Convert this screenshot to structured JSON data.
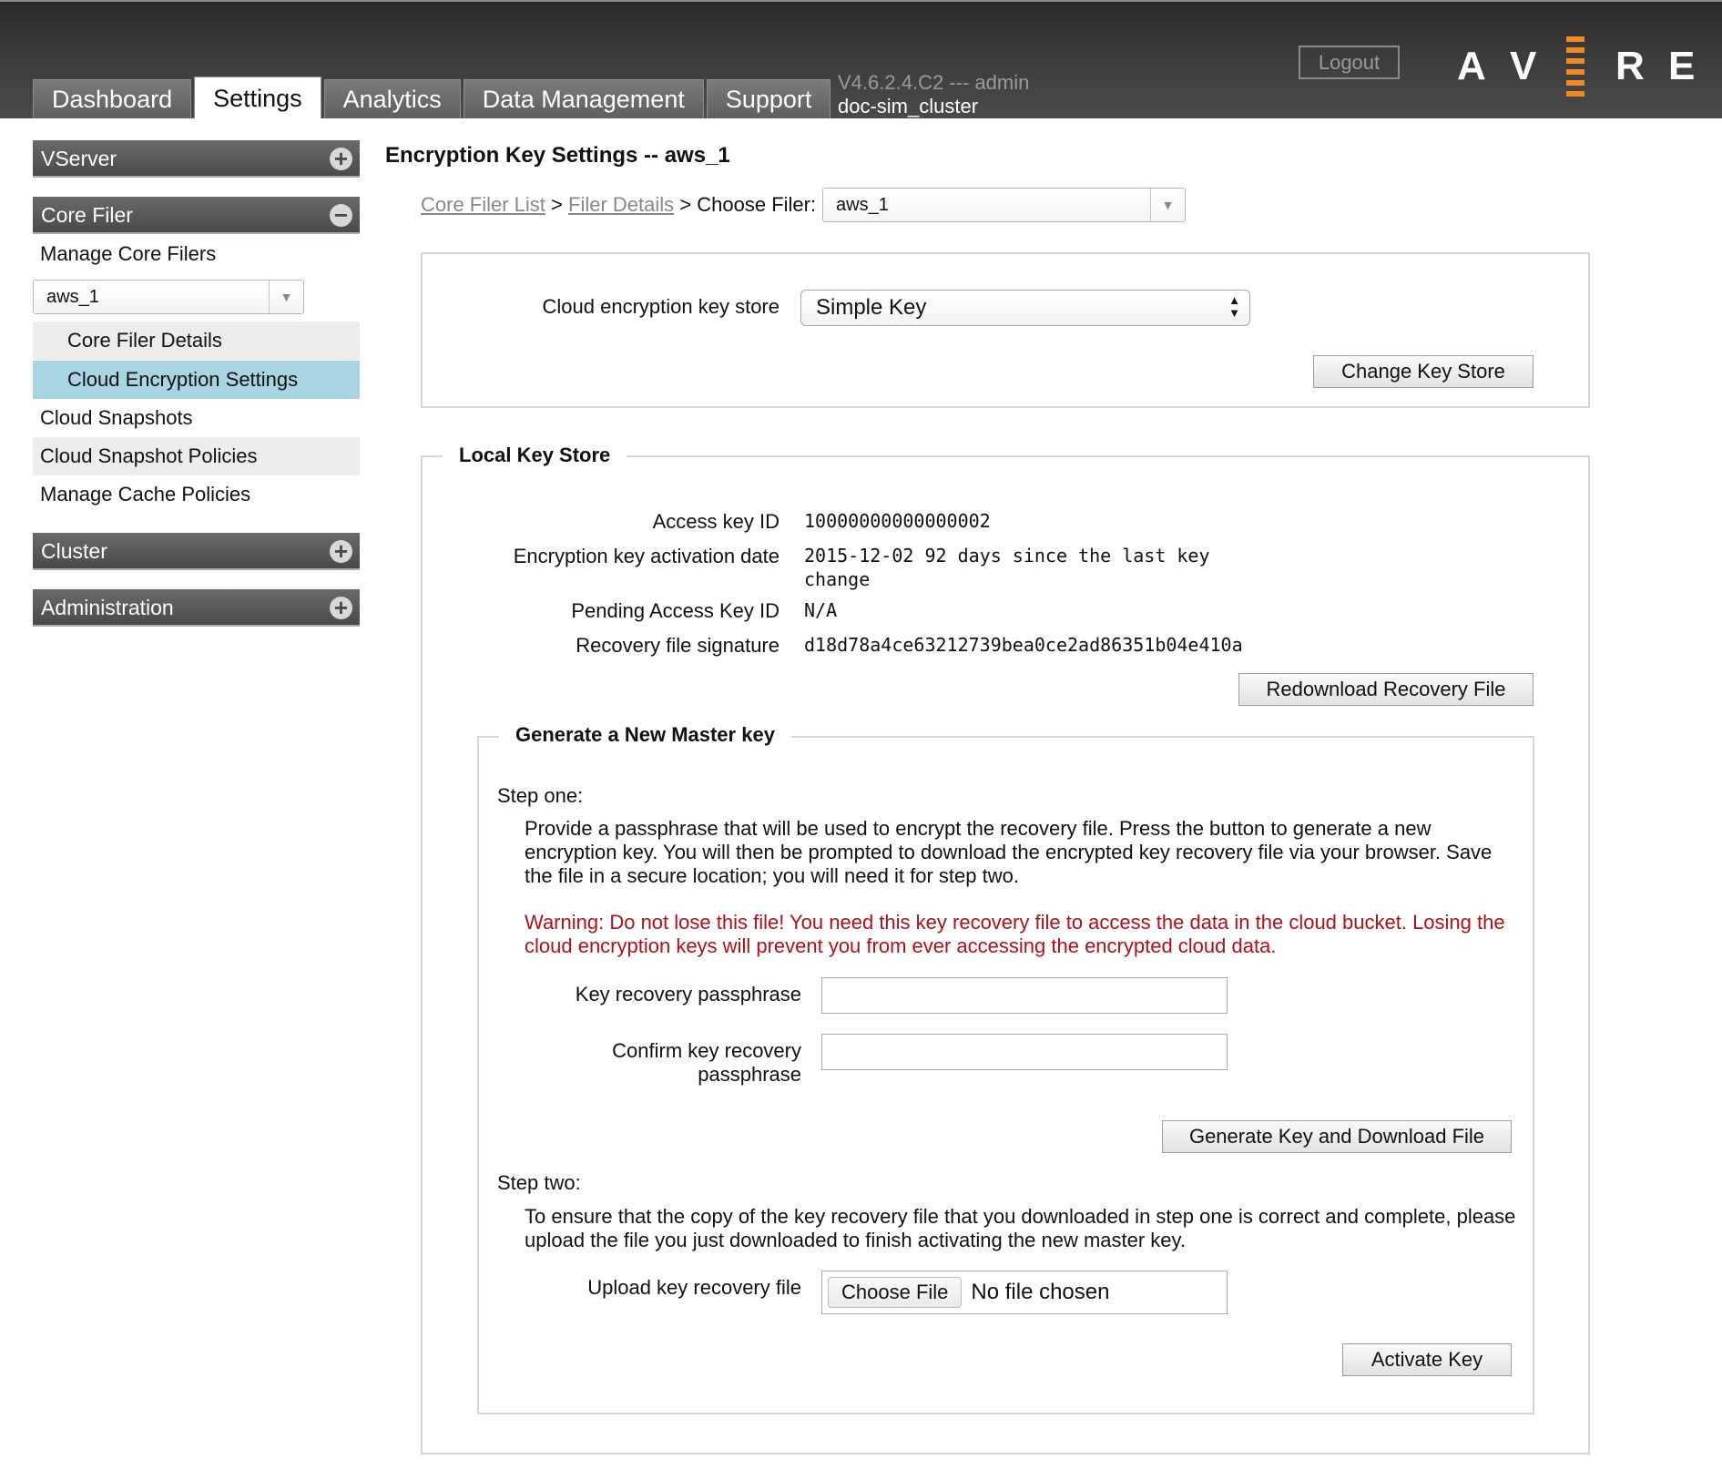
{
  "header": {
    "tabs": [
      "Dashboard",
      "Settings",
      "Analytics",
      "Data Management",
      "Support"
    ],
    "version": "V4.6.2.4.C2 --- admin",
    "cluster": "doc-sim_cluster",
    "logout": "Logout",
    "logo_letters": [
      "A",
      "V",
      "E",
      "R",
      "E"
    ]
  },
  "sidebar": {
    "vserver": "VServer",
    "core_filer": "Core Filer",
    "manage_core_filers": "Manage Core Filers",
    "filer_select": "aws_1",
    "core_filer_details": "Core Filer Details",
    "cloud_encryption_settings": "Cloud Encryption Settings",
    "cloud_snapshots": "Cloud Snapshots",
    "cloud_snapshot_policies": "Cloud Snapshot Policies",
    "manage_cache_policies": "Manage Cache Policies",
    "cluster": "Cluster",
    "administration": "Administration",
    "plus": "+",
    "minus": "−"
  },
  "main": {
    "title": "Encryption Key Settings -- aws_1",
    "breadcrumb": {
      "core_filer_list": "Core Filer List",
      "sep": ">",
      "filer_details": "Filer Details",
      "choose_filer": "Choose Filer:",
      "filer_value": "aws_1"
    },
    "key_store": {
      "label": "Cloud encryption key store",
      "value": "Simple Key",
      "button": "Change Key Store"
    },
    "local_key_store": {
      "legend": "Local Key Store",
      "access_key_id_label": "Access key ID",
      "access_key_id": "10000000000000002",
      "activation_date_label": "Encryption key activation date",
      "activation_date_line1": "2015-12-02 92 days since the last key",
      "activation_date_line2": "change",
      "pending_label": "Pending Access Key ID",
      "pending_value": "N/A",
      "signature_label": "Recovery file signature",
      "signature_value": "d18d78a4ce63212739bea0ce2ad86351b04e410a",
      "redownload_button": "Redownload Recovery File"
    },
    "generate": {
      "legend": "Generate a New Master key",
      "step_one": "Step one:",
      "step_one_text": "Provide a passphrase that will be used to encrypt the recovery file. Press the button to generate a new encryption key. You will then be prompted to download the encrypted key recovery file via your browser. Save the file in a secure location; you will need it for step two.",
      "warning": "Warning: Do not lose this file! You need this key recovery file to access the data in the cloud bucket. Losing the cloud encryption keys will prevent you from ever accessing the encrypted cloud data.",
      "passphrase_label": "Key recovery passphrase",
      "confirm_label_1": "Confirm key recovery",
      "confirm_label_2": "passphrase",
      "passphrase_value": "",
      "confirm_value": "",
      "generate_button": "Generate Key and Download File",
      "step_two": "Step two:",
      "step_two_text": "To ensure that the copy of the key recovery file that you downloaded in step one is correct and complete, please upload the file you just downloaded to finish activating the new master key.",
      "upload_label": "Upload key recovery file",
      "choose_file": "Choose File",
      "no_file": "No file chosen",
      "activate_button": "Activate Key"
    }
  },
  "colors": {
    "selected_item": "#a9d4e1",
    "warning": "#b0101a",
    "logo_accent": "#f08a24"
  }
}
